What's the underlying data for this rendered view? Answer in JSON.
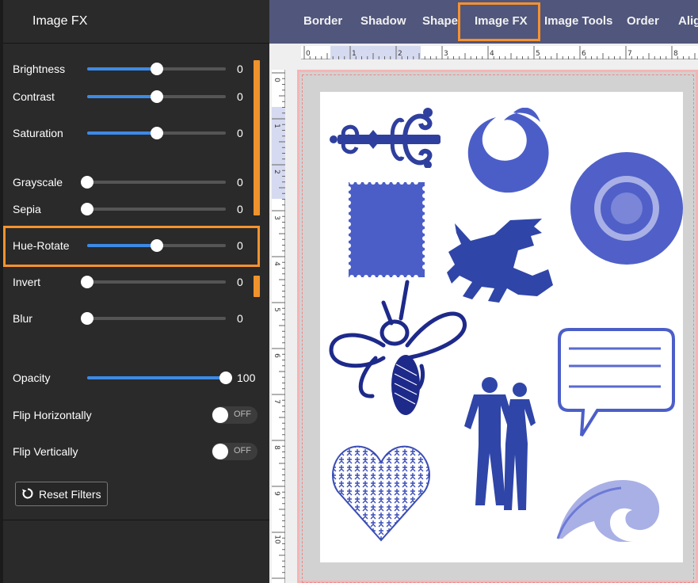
{
  "panel": {
    "title": "Image FX",
    "sliders": [
      {
        "label": "Brightness",
        "value": "0",
        "fill": 0.5
      },
      {
        "label": "Contrast",
        "value": "0",
        "fill": 0.5
      },
      {
        "label": "Saturation",
        "value": "0",
        "fill": 0.5
      },
      {
        "label": "Grayscale",
        "value": "0",
        "fill": 0.0
      },
      {
        "label": "Sepia",
        "value": "0",
        "fill": 0.0
      },
      {
        "label": "Hue-Rotate",
        "value": "0",
        "fill": 0.5
      },
      {
        "label": "Invert",
        "value": "0",
        "fill": 0.0
      },
      {
        "label": "Blur",
        "value": "0",
        "fill": 0.0
      },
      {
        "label": "Opacity",
        "value": "100",
        "fill": 1.0
      }
    ],
    "toggles": [
      {
        "label": "Flip Horizontally",
        "state": "OFF"
      },
      {
        "label": "Flip Vertically",
        "state": "OFF"
      }
    ],
    "reset_label": "Reset Filters"
  },
  "toolbar": {
    "tabs": [
      "Border",
      "Shadow",
      "Shape",
      "Image FX",
      "Image Tools",
      "Order",
      "Alig"
    ],
    "active_tab": "Image FX"
  },
  "ruler": {
    "h": [
      "0",
      "1",
      "2",
      "3",
      "4",
      "5",
      "6",
      "7",
      "8"
    ],
    "v": [
      "0",
      "1",
      "2",
      "3",
      "4",
      "5",
      "6",
      "7",
      "8",
      "9",
      "10"
    ]
  },
  "colors": {
    "accent_orange": "#f7922e",
    "slider_blue": "#3d8ae6",
    "toolbar": "#50567c",
    "art_blue": "#3f4fb8"
  }
}
